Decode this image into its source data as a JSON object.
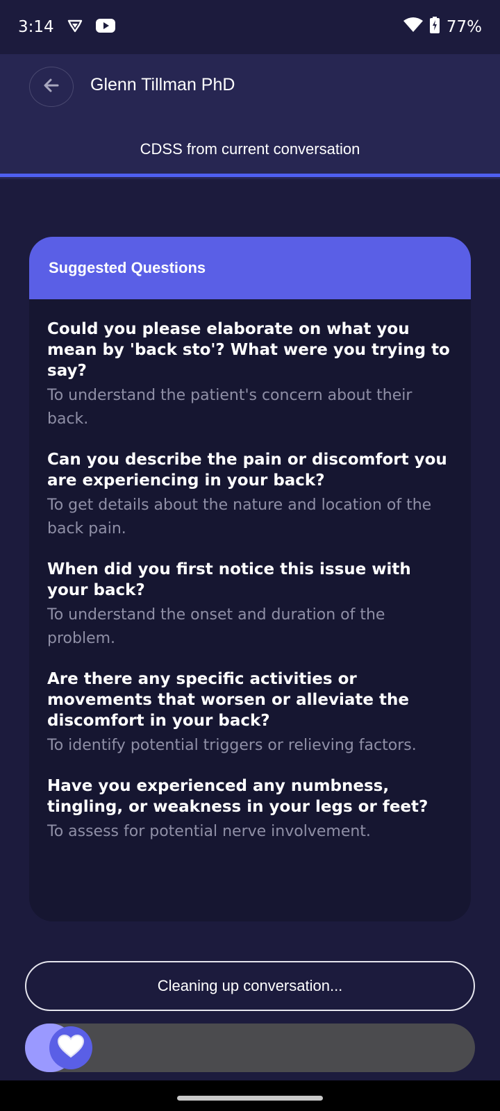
{
  "status_bar": {
    "time": "3:14",
    "battery": "77%",
    "icons": [
      "vpn-shield-icon",
      "youtube-icon",
      "wifi-icon",
      "battery-charging-icon"
    ]
  },
  "header": {
    "title": "Glenn Tillman PhD",
    "subtitle": "CDSS from current conversation",
    "back_icon": "arrow-left-icon"
  },
  "card": {
    "title": "Suggested Questions",
    "questions": [
      {
        "question": "Could you please elaborate on what you mean by 'back sto'? What were you trying to say?",
        "reason": "To understand the patient's concern about their back."
      },
      {
        "question": "Can you describe the pain or discomfort you are experiencing in your back?",
        "reason": "To get details about the nature and location of the back pain."
      },
      {
        "question": "When did you first notice this issue with your back?",
        "reason": "To understand the onset and duration of the problem."
      },
      {
        "question": "Are there any specific activities or movements that worsen or alleviate the discomfort in your back?",
        "reason": "To identify potential triggers or relieving factors."
      },
      {
        "question": "Have you experienced any numbness, tingling, or weakness in your legs or feet?",
        "reason": "To assess for potential nerve involvement."
      }
    ]
  },
  "actions": {
    "cleanup_label": "Cleaning up conversation..."
  },
  "colors": {
    "background": "#1c1b3d",
    "header": "#272652",
    "accent": "#5a5fe6",
    "card": "#161631"
  }
}
